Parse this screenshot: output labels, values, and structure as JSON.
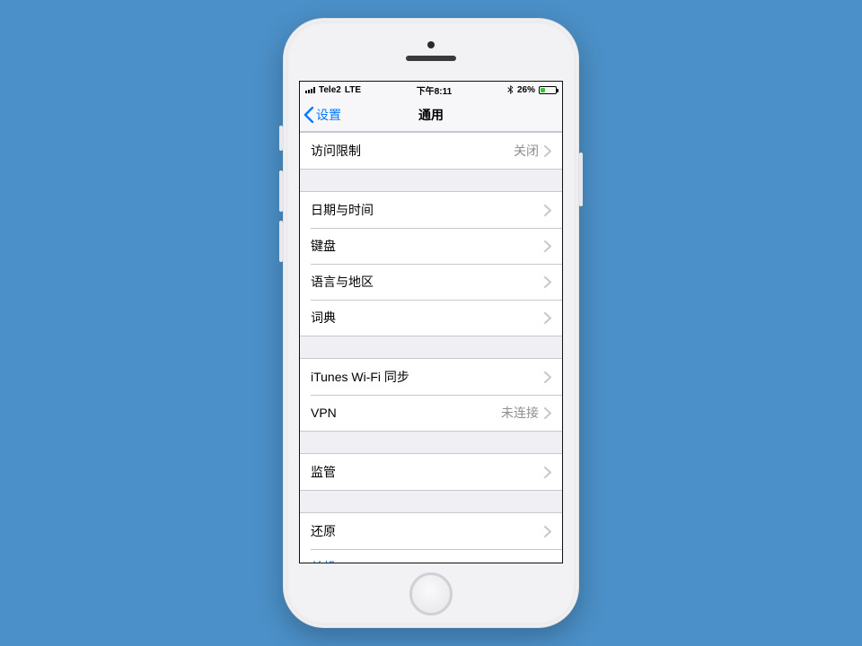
{
  "status": {
    "carrier": "Tele2",
    "network": "LTE",
    "time": "下午8:11",
    "bluetooth_icon": "bluetooth",
    "battery_pct_text": "26%",
    "battery_pct": 26
  },
  "nav": {
    "back_label": "设置",
    "title": "通用"
  },
  "groups": [
    {
      "rows": [
        {
          "label": "访问限制",
          "value": "关闭",
          "chevron": true
        }
      ]
    },
    {
      "rows": [
        {
          "label": "日期与时间",
          "value": "",
          "chevron": true
        },
        {
          "label": "键盘",
          "value": "",
          "chevron": true
        },
        {
          "label": "语言与地区",
          "value": "",
          "chevron": true
        },
        {
          "label": "词典",
          "value": "",
          "chevron": true
        }
      ]
    },
    {
      "rows": [
        {
          "label": "iTunes Wi-Fi 同步",
          "value": "",
          "chevron": true
        },
        {
          "label": "VPN",
          "value": "未连接",
          "chevron": true
        }
      ]
    },
    {
      "rows": [
        {
          "label": "监管",
          "value": "",
          "chevron": true
        }
      ]
    },
    {
      "rows": [
        {
          "label": "还原",
          "value": "",
          "chevron": true
        },
        {
          "label": "关机",
          "value": "",
          "chevron": false,
          "link": true
        }
      ]
    }
  ]
}
